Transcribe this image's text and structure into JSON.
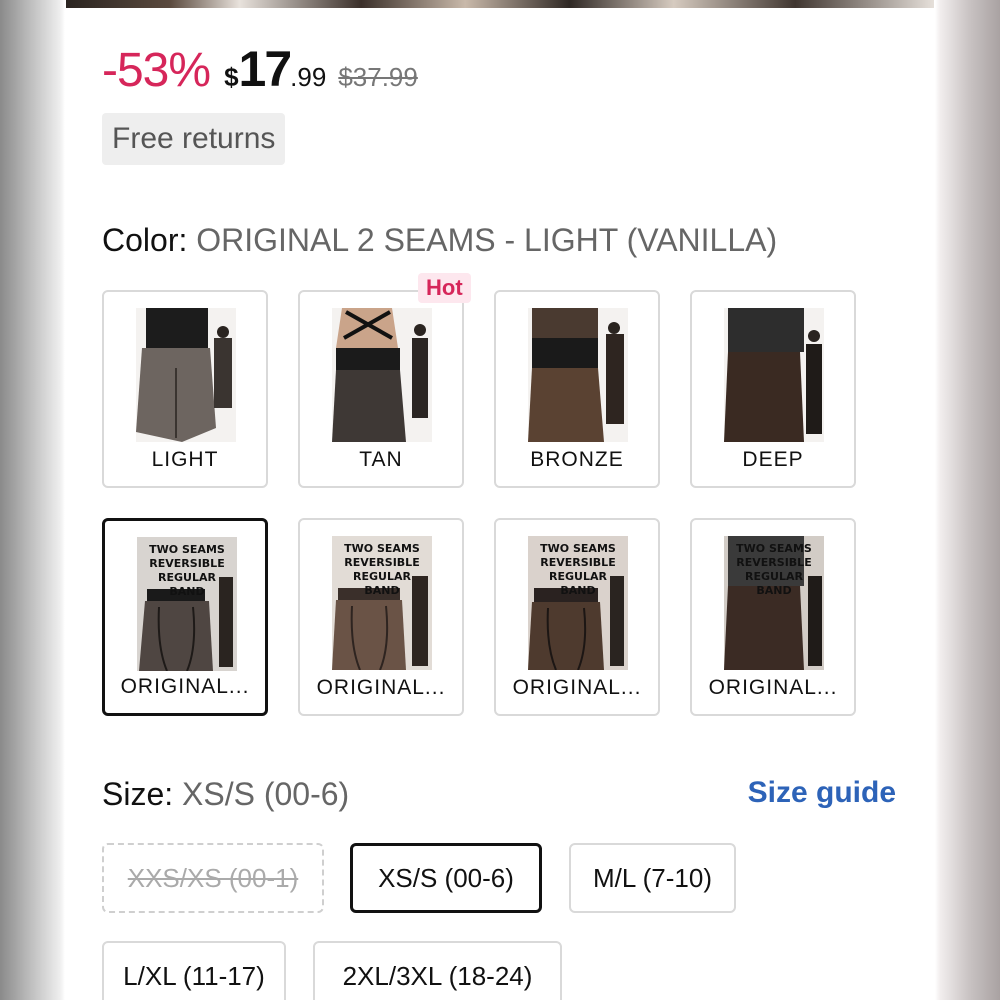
{
  "price": {
    "discount": "-53%",
    "currency": "$",
    "integer": "17",
    "decimal": ".99",
    "original": "$37.99"
  },
  "badge": {
    "free_returns": "Free returns"
  },
  "color": {
    "label": "Color:",
    "selected": "ORIGINAL 2 SEAMS - LIGHT (VANILLA)",
    "hot_label": "Hot",
    "swatches": [
      {
        "label": "LIGHT"
      },
      {
        "label": "TAN"
      },
      {
        "label": "BRONZE"
      },
      {
        "label": "DEEP"
      },
      {
        "label": "ORIGINAL...",
        "banner": "TWO SEAMS\nREVERSIBLE\nREGULAR BAND"
      },
      {
        "label": "ORIGINAL...",
        "banner": "TWO SEAMS\nREVERSIBLE\nREGULAR BAND"
      },
      {
        "label": "ORIGINAL...",
        "banner": "TWO SEAMS\nREVERSIBLE\nREGULAR BAND"
      },
      {
        "label": "ORIGINAL...",
        "banner": "TWO SEAMS\nREVERSIBLE\nREGULAR BAND"
      }
    ]
  },
  "size": {
    "label": "Size:",
    "selected": "XS/S (00-6)",
    "guide": "Size guide",
    "options": [
      {
        "label": "XXS/XS (00-1)"
      },
      {
        "label": "XS/S (00-6)"
      },
      {
        "label": "M/L (7-10)"
      },
      {
        "label": "L/XL (11-17)"
      },
      {
        "label": "2XL/3XL (18-24)"
      }
    ]
  },
  "colors": {
    "discount": "#d6265a",
    "link": "#2d63b8",
    "selected_border": "#111111"
  }
}
